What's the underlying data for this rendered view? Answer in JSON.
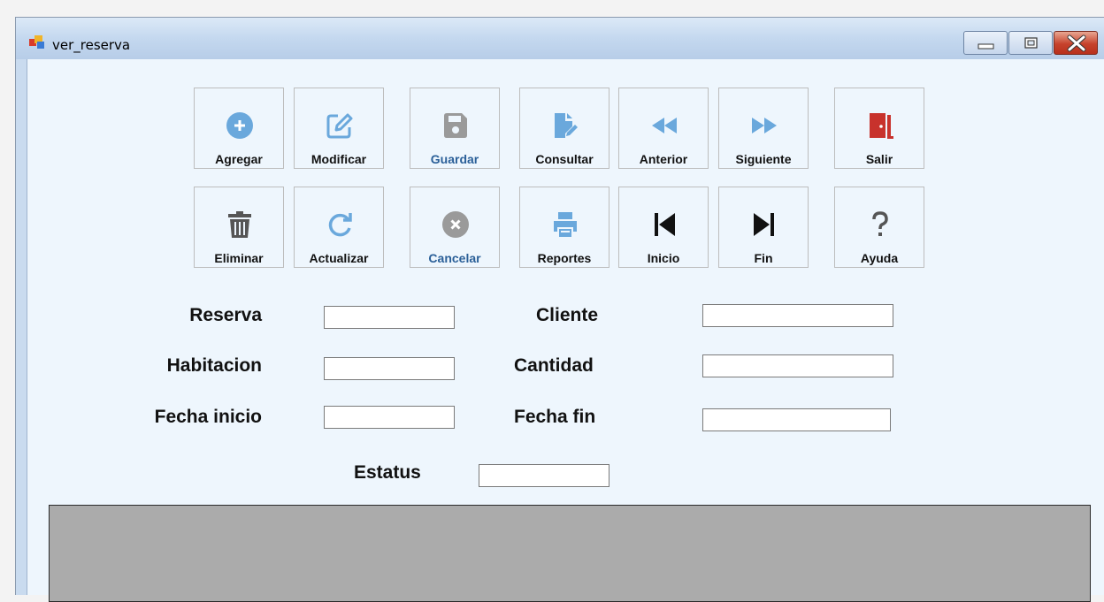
{
  "window": {
    "title": "ver_reserva"
  },
  "toolbar": {
    "row1": [
      {
        "label": "Agregar",
        "icon": "plus-circle-icon"
      },
      {
        "label": "Modificar",
        "icon": "edit-icon"
      },
      {
        "label": "Guardar",
        "icon": "save-icon"
      },
      {
        "label": "Consultar",
        "icon": "file-edit-icon"
      },
      {
        "label": "Anterior",
        "icon": "rewind-icon"
      },
      {
        "label": "Siguiente",
        "icon": "fast-forward-icon"
      },
      {
        "label": "Salir",
        "icon": "exit-door-icon"
      }
    ],
    "row2": [
      {
        "label": "Eliminar",
        "icon": "trash-icon"
      },
      {
        "label": "Actualizar",
        "icon": "refresh-icon"
      },
      {
        "label": "Cancelar",
        "icon": "cancel-circle-icon"
      },
      {
        "label": "Reportes",
        "icon": "printer-icon"
      },
      {
        "label": "Inicio",
        "icon": "skip-first-icon"
      },
      {
        "label": "Fin",
        "icon": "skip-last-icon"
      },
      {
        "label": "Ayuda",
        "icon": "question-icon"
      }
    ]
  },
  "form": {
    "reserva": {
      "label": "Reserva",
      "value": ""
    },
    "cliente": {
      "label": "Cliente",
      "value": ""
    },
    "habitacion": {
      "label": "Habitacion",
      "value": ""
    },
    "cantidad": {
      "label": "Cantidad",
      "value": ""
    },
    "fecha_inicio": {
      "label": "Fecha inicio",
      "value": ""
    },
    "fecha_fin": {
      "label": "Fecha fin",
      "value": ""
    },
    "estatus": {
      "label": "Estatus",
      "value": ""
    }
  },
  "colors": {
    "accent_blue": "#6aa8dc",
    "disabled_gray": "#9a9a9a",
    "exit_red": "#c8322c",
    "grid_bg": "#ababab"
  }
}
